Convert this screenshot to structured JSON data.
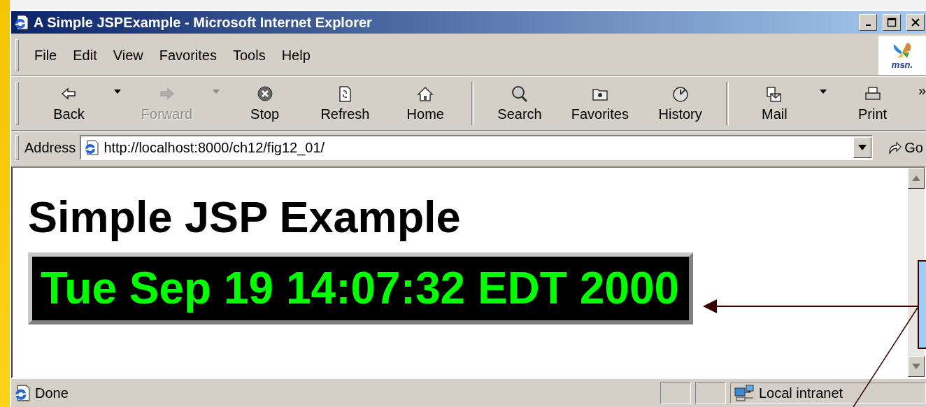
{
  "window": {
    "title": "A Simple JSPExample - Microsoft Internet Explorer"
  },
  "menu": [
    "File",
    "Edit",
    "View",
    "Favorites",
    "Tools",
    "Help"
  ],
  "logo": {
    "text": "msn."
  },
  "toolbar": [
    {
      "kind": "back",
      "label": "Back",
      "disabled": false,
      "dropdown": true
    },
    {
      "kind": "forward",
      "label": "Forward",
      "disabled": true,
      "dropdown": true
    },
    {
      "kind": "stop",
      "label": "Stop",
      "disabled": false,
      "dropdown": false
    },
    {
      "kind": "refresh",
      "label": "Refresh",
      "disabled": false,
      "dropdown": false
    },
    {
      "kind": "home",
      "label": "Home",
      "disabled": false,
      "dropdown": false
    },
    {
      "kind": "separator"
    },
    {
      "kind": "search",
      "label": "Search",
      "disabled": false,
      "dropdown": false
    },
    {
      "kind": "favorites",
      "label": "Favorites",
      "disabled": false,
      "dropdown": false
    },
    {
      "kind": "history",
      "label": "History",
      "disabled": false,
      "dropdown": false
    },
    {
      "kind": "separator"
    },
    {
      "kind": "mail",
      "label": "Mail",
      "disabled": false,
      "dropdown": true
    },
    {
      "kind": "print",
      "label": "Print",
      "disabled": false,
      "dropdown": false
    }
  ],
  "toolbar_more": "»",
  "address": {
    "label": "Address",
    "value": "http://localhost:8000/ch12/fig12_01/",
    "go": "Go"
  },
  "page": {
    "heading": "Simple JSP Example",
    "clock": "Tue Sep 19 14:07:32 EDT 2000"
  },
  "status": {
    "text": "Done",
    "zone": "Local intranet"
  }
}
